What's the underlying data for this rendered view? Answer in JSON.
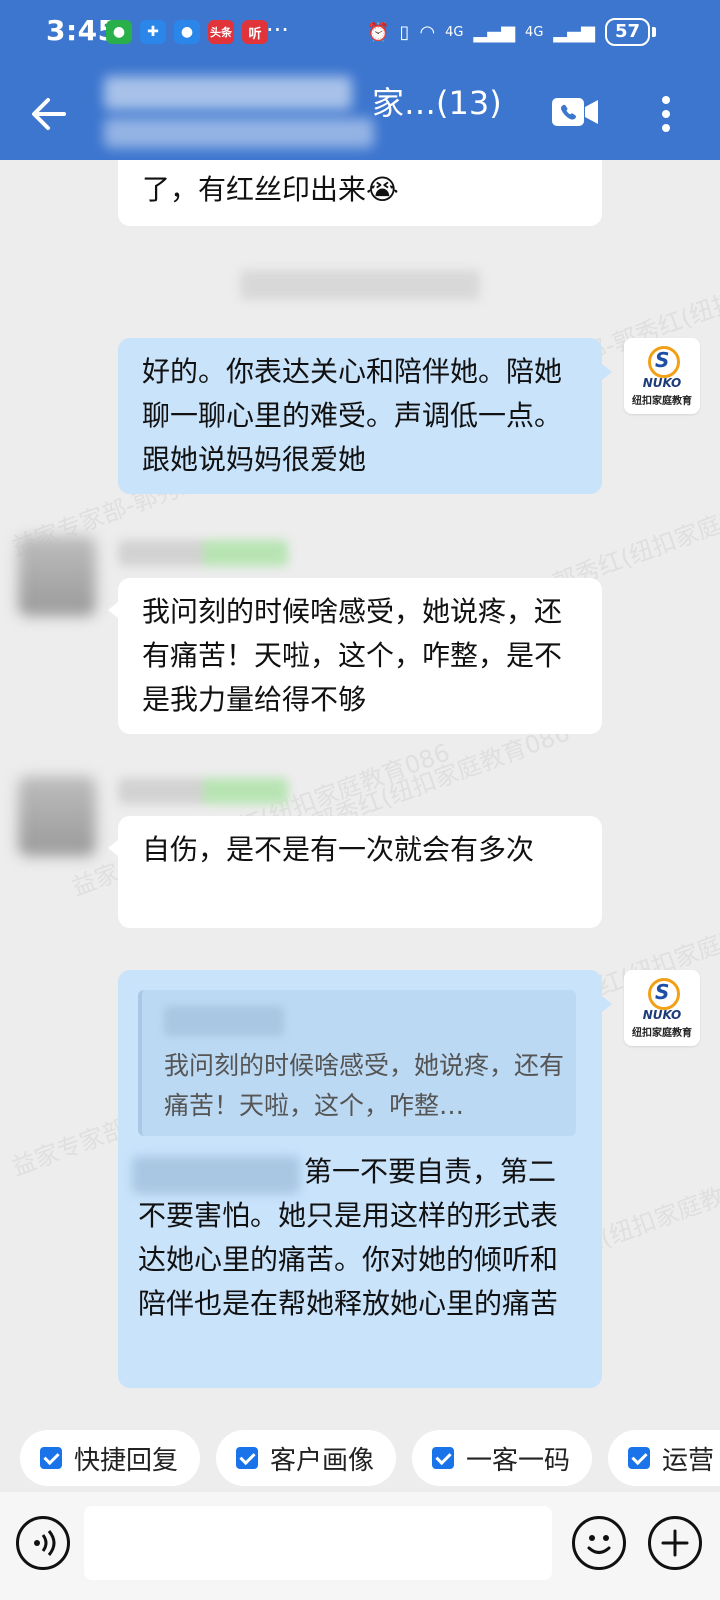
{
  "status_bar": {
    "time": "3:45",
    "battery": "57",
    "signal_label_1": "4G",
    "signal_label_2": "4G",
    "app_badges": [
      "头条",
      "听"
    ]
  },
  "header": {
    "title": "家…(13)"
  },
  "messages": [
    {
      "side": "left",
      "text": "了，有红丝印出来😭"
    },
    {
      "side": "right",
      "text": "好的。你表达关心和陪伴她。陪她聊一聊心里的难受。声调低一点。跟她说妈妈很爱她"
    },
    {
      "side": "left",
      "text": "我问刻的时候啥感受，她说疼，还有痛苦！天啦，这个，咋整，是不是我力量给得不够"
    },
    {
      "side": "left",
      "text": "自伤，是不是有一次就会有多次"
    },
    {
      "side": "right",
      "quote": "我问刻的时候啥感受，她说疼，还有痛苦！天啦，这个，咋整…",
      "text": "第一不要自责，第二不要害怕。她只是用这样的形式表达她心里的痛苦。你对她的倾听和陪伴也是在帮她释放她心里的痛苦"
    }
  ],
  "logo": {
    "brand": "NUKO",
    "cn": "纽扣家庭教育"
  },
  "watermark": "益家专家部-郭秀红(纽扣家庭教育086",
  "quick_actions": [
    "快捷回复",
    "客户画像",
    "一客一码",
    "运营"
  ],
  "input": {
    "placeholder": ""
  },
  "icons": {
    "back": "back-arrow-icon",
    "video": "video-call-icon",
    "more": "more-vertical-icon",
    "voice": "voice-input-icon",
    "emoji": "emoji-icon",
    "plus": "plus-icon"
  },
  "colors": {
    "header": "#3d76cf",
    "bubble_out": "#c9e3fb",
    "bubble_in": "#ffffff",
    "chip_check": "#1a73e8"
  }
}
